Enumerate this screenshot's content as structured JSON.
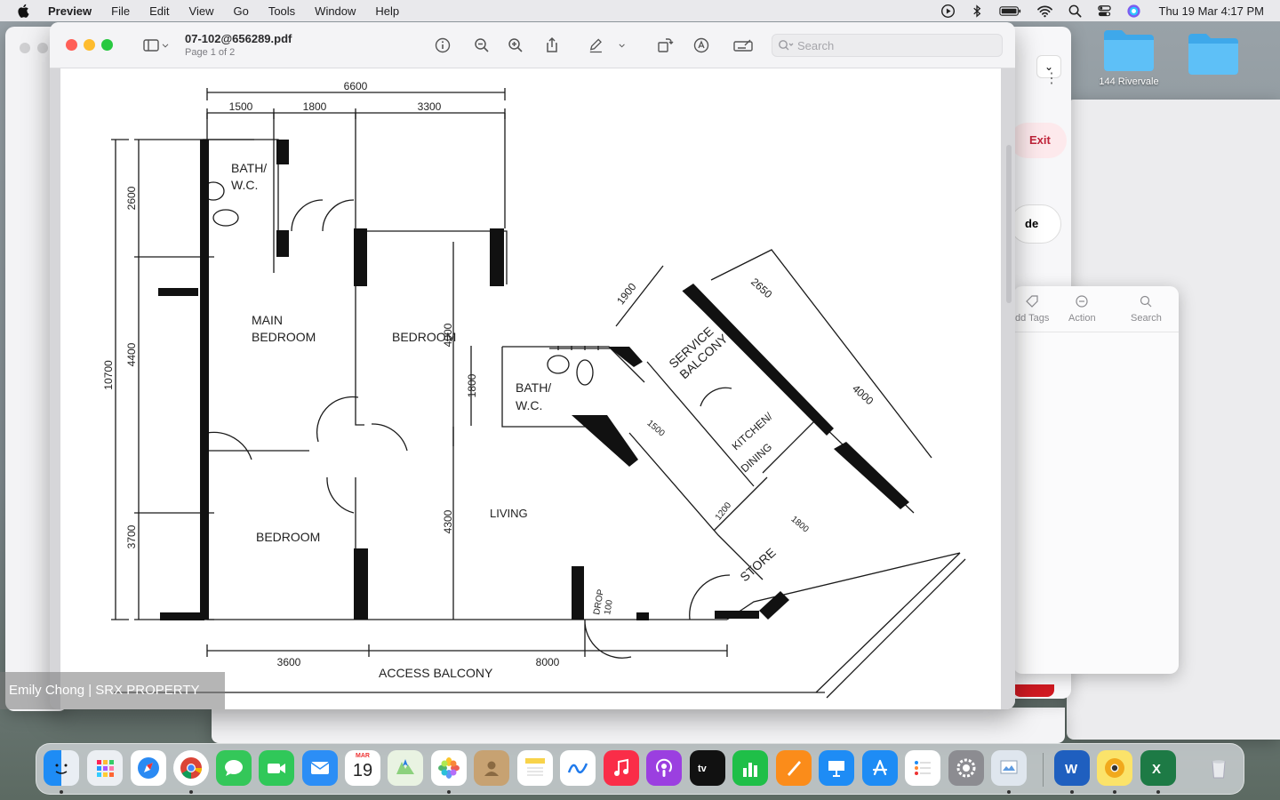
{
  "menubar": {
    "app_name": "Preview",
    "items": [
      "File",
      "Edit",
      "View",
      "Go",
      "Tools",
      "Window",
      "Help"
    ],
    "clock": "Thu 19 Mar  4:17 PM"
  },
  "desktop": {
    "folders": [
      {
        "label": "144 Rivervale"
      },
      {
        "label": ""
      }
    ]
  },
  "preview": {
    "doc_title": "07-102@656289.pdf",
    "page_info": "Page 1 of 2",
    "search_placeholder": "Search"
  },
  "floorplan": {
    "dimensions": {
      "top_total": "6600",
      "top_a": "1500",
      "top_b": "1800",
      "top_c": "3300",
      "left_total": "10700",
      "left_a": "2600",
      "left_b": "4400",
      "left_c": "3700",
      "bottom_a": "3600",
      "bottom_b": "8000",
      "diag_a": "1900",
      "diag_b": "2650",
      "diag_c": "4000",
      "bedroom_w": "4000",
      "bath_h": "1800",
      "living_h": "4300",
      "misc_a": "1200",
      "misc_b": "1800",
      "misc_c": "1500"
    },
    "rooms": {
      "bath1_line1": "BATH/",
      "bath1_line2": "W.C.",
      "main_line1": "MAIN",
      "main_line2": "BEDROOM",
      "bedroom2": "BEDROOM",
      "bath2_line1": "BATH/",
      "bath2_line2": "W.C.",
      "service_line1": "SERVICE",
      "service_line2": "BALCONY",
      "kitchen": "KITCHEN/",
      "dining": "DINING",
      "living": "LIVING",
      "bedroom3": "BEDROOM",
      "store": "STORE",
      "refuse_line1": "DROP",
      "refuse_line2": "100",
      "access_balcony": "ACCESS BALCONY"
    }
  },
  "watermark": "Emily Chong | SRX PROPERTY",
  "background_windows": {
    "browser_exit": "Exit",
    "browser_pill": "de",
    "finder_tags": "dd Tags",
    "finder_action": "Action",
    "finder_search": "Search"
  },
  "dock": {
    "calendar_month": "MAR",
    "calendar_day": "19",
    "apps": [
      "Finder",
      "Launchpad",
      "Safari",
      "Chrome",
      "Messages",
      "FaceTime",
      "Mail",
      "Calendar",
      "Maps",
      "Photos",
      "Contacts",
      "Notes",
      "Freeform",
      "Music",
      "Podcasts",
      "TV",
      "Numbers",
      "Pages",
      "Keynote",
      "App Store",
      "Reminders",
      "System Settings",
      "Preview",
      "Word",
      "Chrome Canary",
      "Excel",
      "Trash"
    ]
  }
}
